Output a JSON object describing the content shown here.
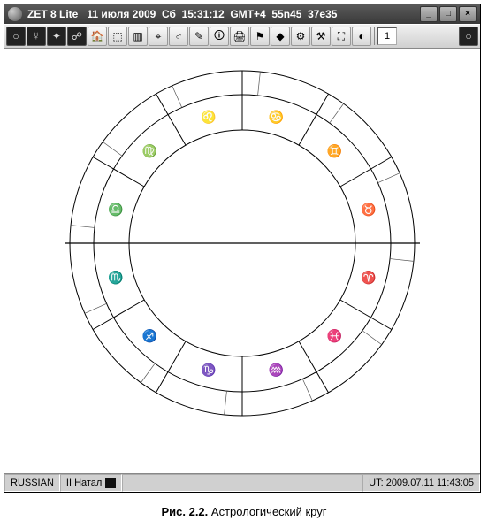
{
  "titlebar": {
    "app": "ZET 8 Lite",
    "date": "11 июля 2009",
    "day": "Сб",
    "time": "15:31:12",
    "tz": "GMT+4",
    "lat": "55n45",
    "lon": "37e35"
  },
  "win_buttons": {
    "min": "_",
    "max": "□",
    "close": "×"
  },
  "toolbar": {
    "icons": [
      "○",
      "☿",
      "✦",
      "☍",
      "🏠",
      "⬚",
      "▥",
      "⌖",
      "♂",
      "✎",
      "🛈",
      "🖨",
      "⚑",
      "◆",
      "⚙",
      "⚒",
      "⛶",
      "◐"
    ],
    "field_value": "1",
    "last_icon": "○"
  },
  "chart_data": {
    "type": "radial",
    "signs_order_ccw_from_left": [
      "libra",
      "virgo",
      "leo",
      "cancer",
      "gemini",
      "taurus",
      "aries",
      "pisces",
      "aquarius",
      "capricorn",
      "sagittarius",
      "scorpio"
    ],
    "glyphs": {
      "aries": "♈",
      "taurus": "♉",
      "gemini": "♊",
      "cancer": "♋",
      "leo": "♌",
      "virgo": "♍",
      "libra": "♎",
      "scorpio": "♏",
      "sagittarius": "♐",
      "capricorn": "♑",
      "aquarius": "♒",
      "pisces": "♓"
    },
    "ring_outer_radius": 195,
    "ring_middle_radius": 168,
    "ring_inner_radius": 128,
    "ascendant_deg_approx": 180
  },
  "statusbar": {
    "lang": "RUSSIAN",
    "mode": "II Натал",
    "ut": "UT: 2009.07.11 11:43:05"
  },
  "caption": {
    "label": "Рис. 2.2.",
    "text": "Астрологический круг"
  }
}
